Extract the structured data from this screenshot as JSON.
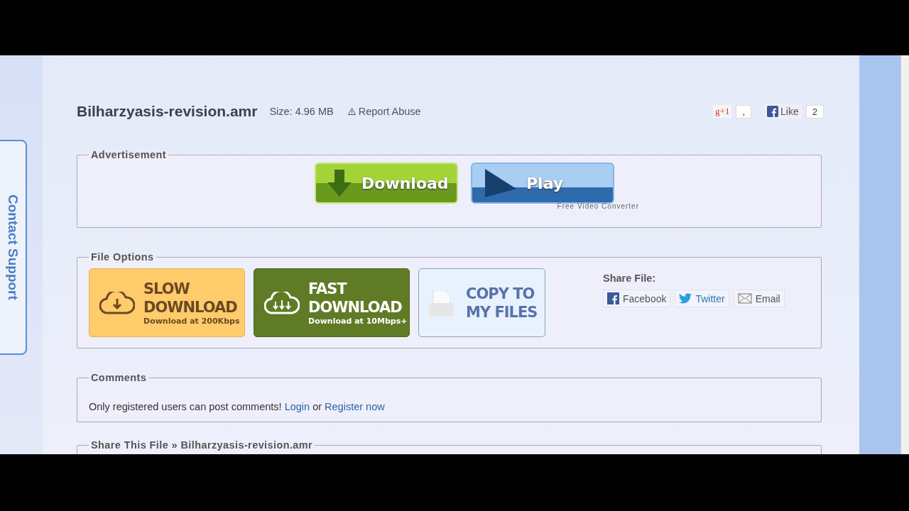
{
  "contact_tab": "Contact Support",
  "file": {
    "name": "Bilharzyasis-revision.amr",
    "size": "Size: 4.96 MB",
    "report": "Report Abuse"
  },
  "social": {
    "gplus": "g+1",
    "gplus_count": ",",
    "like": "Like",
    "like_count": "2"
  },
  "advertisement": {
    "legend": "Advertisement",
    "buttons": [
      {
        "kind": "download",
        "label": "Download"
      },
      {
        "kind": "play",
        "label": "Play"
      }
    ],
    "caption": "Free Video Converter"
  },
  "file_options": {
    "legend": "File Options",
    "options": [
      {
        "kind": "slow",
        "title": "SLOW DOWNLOAD",
        "subtitle": "Download at 200Kbps"
      },
      {
        "kind": "fast",
        "title": "FAST DOWNLOAD",
        "subtitle": "Download at 10Mbps+"
      },
      {
        "kind": "copy",
        "title": "COPY TO MY FILES"
      }
    ],
    "share": {
      "label": "Share File:",
      "links": [
        {
          "kind": "facebook",
          "label": "Facebook"
        },
        {
          "kind": "twitter",
          "label": "Twitter"
        },
        {
          "kind": "email",
          "label": "Email"
        }
      ]
    }
  },
  "comments": {
    "legend": "Comments",
    "text": "Only registered users can post comments!",
    "login": "Login",
    "or": "or",
    "register": "Register now"
  },
  "share_section": {
    "legend": "Share This File » Bilharzyasis-revision.amr"
  }
}
